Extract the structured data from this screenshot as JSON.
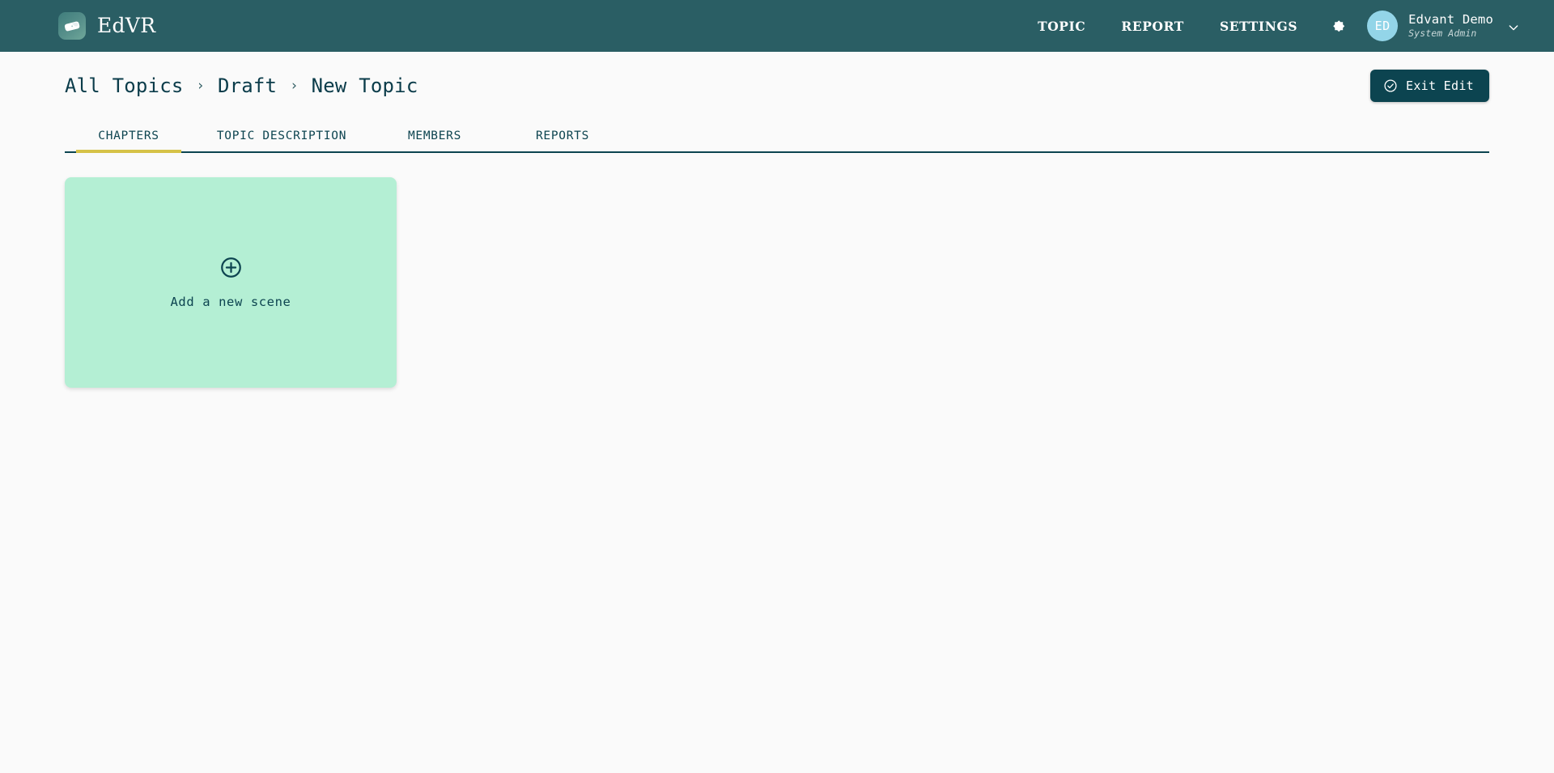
{
  "header": {
    "brand": {
      "name": "EdVR",
      "logo_icon": "vr-goggles-icon"
    },
    "nav": [
      {
        "label": "TOPIC",
        "name": "topic"
      },
      {
        "label": "REPORT",
        "name": "report"
      },
      {
        "label": "SETTINGS",
        "name": "settings"
      }
    ],
    "theme_toggle_icon": "brightness-dark-mode-icon",
    "user": {
      "initials": "ED",
      "name": "Edvant Demo",
      "role": "System Admin",
      "caret_icon": "chevron-down-icon"
    }
  },
  "breadcrumb": {
    "separator": "›",
    "items": [
      {
        "label": "All Topics"
      },
      {
        "label": "Draft"
      },
      {
        "label": "New Topic"
      }
    ]
  },
  "actions": {
    "exit_edit_label": "Exit Edit",
    "exit_edit_icon": "check-circle-icon"
  },
  "tabs": [
    {
      "label": "CHAPTERS",
      "name": "chapters",
      "active": true
    },
    {
      "label": "TOPIC DESCRIPTION",
      "name": "topic-description",
      "active": false
    },
    {
      "label": "MEMBERS",
      "name": "members",
      "active": false
    },
    {
      "label": "REPORTS",
      "name": "reports",
      "active": false
    }
  ],
  "content": {
    "add_scene": {
      "label": "Add a new scene",
      "icon": "plus-circle-icon"
    }
  },
  "colors": {
    "header_bg": "#2a5e64",
    "accent_teal": "#0c4450",
    "tab_active_underline": "#d6c247",
    "card_bg": "#b4efd4",
    "avatar_bg": "#93d5e8",
    "page_bg": "#fafafa"
  }
}
